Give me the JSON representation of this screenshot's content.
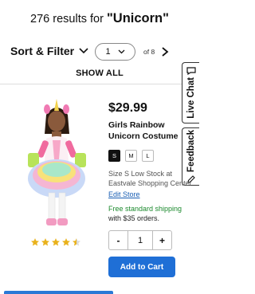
{
  "search": {
    "count_text": "276 results for",
    "query": "\"Unicorn\""
  },
  "toolbar": {
    "sort_filter_label": "Sort & Filter",
    "page_value": "1",
    "page_of": "of 8",
    "icons": [
      "chevron-down-icon",
      "chevron-right-icon"
    ]
  },
  "show_all_label": "SHOW ALL",
  "side_tabs": {
    "live_chat": "Live Chat",
    "feedback": "Feedback"
  },
  "product": {
    "price": "$29.99",
    "title": "Girls Rainbow Unicorn Costume",
    "sizes": [
      {
        "label": "S",
        "selected": true
      },
      {
        "label": "M",
        "selected": false
      },
      {
        "label": "L",
        "selected": false
      }
    ],
    "stock_line1": "Size S Low Stock at",
    "stock_line2": "Eastvale Shopping Center",
    "edit_store": "Edit Store",
    "shipping_line1": "Free standard shipping",
    "shipping_line2": "with $35 orders.",
    "quantity": "1",
    "minus_label": "-",
    "plus_label": "+",
    "add_to_cart": "Add to Cart",
    "rating": 4.5,
    "rating_max": 5
  },
  "colors": {
    "accent_blue": "#1f6fd6",
    "link_blue": "#1a5fb4",
    "shipping_green": "#1c8a2e",
    "star_gold": "#e9b21c"
  }
}
